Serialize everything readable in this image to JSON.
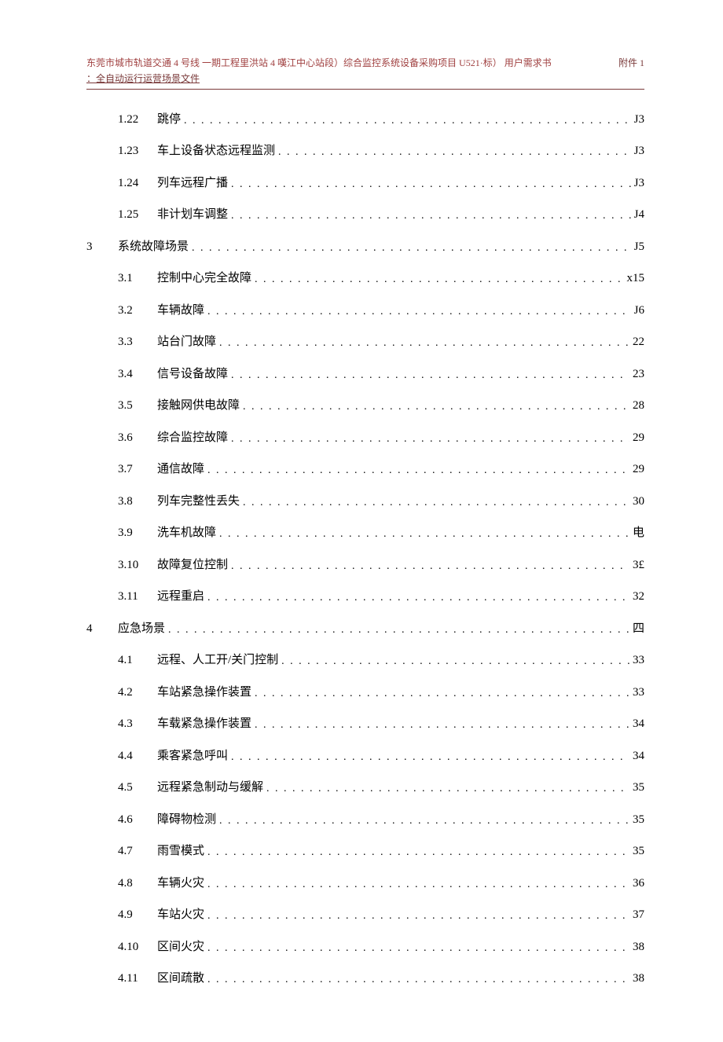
{
  "header": {
    "line1_a": "东莞市城市轨道交通 4",
    "line1_b": "号线",
    "line1_c": "一期工程里洪站 4 嘆江中心站段）综合监控系统设备采购项目 U521·标）",
    "line1_d": "用户需求书",
    "line1_right": "附件 1",
    "line2": "：全自动运行运营场景文件"
  },
  "toc": [
    {
      "lvl": 2,
      "num": "1.22",
      "title": "跳停",
      "page": "J3"
    },
    {
      "lvl": 2,
      "num": "1.23",
      "title": "车上设备状态远程监测",
      "page": "J3"
    },
    {
      "lvl": 2,
      "num": "1.24",
      "title": "列车远程广播",
      "page": "J3"
    },
    {
      "lvl": 2,
      "num": "1.25",
      "title": "非计划车调整",
      "page": "J4"
    },
    {
      "lvl": 1,
      "num": "3",
      "title": "系统故障场景",
      "page": "J5"
    },
    {
      "lvl": 2,
      "num": "3.1",
      "title": "控制中心完全故障",
      "page": "x15"
    },
    {
      "lvl": 2,
      "num": "3.2",
      "title": "车辆故障",
      "page": "J6"
    },
    {
      "lvl": 2,
      "num": "3.3",
      "title": "站台门故障",
      "page": "22"
    },
    {
      "lvl": 2,
      "num": "3.4",
      "title": "信号设备故障",
      "page": "23"
    },
    {
      "lvl": 2,
      "num": "3.5",
      "title": "接触网供电故障",
      "page": "28"
    },
    {
      "lvl": 2,
      "num": "3.6",
      "title": "综合监控故障",
      "page": "29"
    },
    {
      "lvl": 2,
      "num": "3.7",
      "title": "通信故障",
      "page": "29"
    },
    {
      "lvl": 2,
      "num": "3.8",
      "title": "列车完整性丢失",
      "page": "30"
    },
    {
      "lvl": 2,
      "num": "3.9",
      "title": "洗车机故障",
      "page": "电"
    },
    {
      "lvl": 2,
      "num": "3.10",
      "title": "故障复位控制",
      "page": "3£"
    },
    {
      "lvl": 2,
      "num": "3.11",
      "title": "远程重启",
      "page": "32"
    },
    {
      "lvl": 1,
      "num": "4",
      "title": "应急场景",
      "page": "四"
    },
    {
      "lvl": 2,
      "num": "4.1",
      "title": "远程、人工开/关门控制",
      "page": "33"
    },
    {
      "lvl": 2,
      "num": "4.2",
      "title": "车站紧急操作装置",
      "page": "33"
    },
    {
      "lvl": 2,
      "num": "4.3",
      "title": "车载紧急操作装置",
      "page": "34"
    },
    {
      "lvl": 2,
      "num": "4.4",
      "title": "乘客紧急呼叫",
      "page": "34"
    },
    {
      "lvl": 2,
      "num": "4.5",
      "title": "远程紧急制动与缓解",
      "page": "35"
    },
    {
      "lvl": 2,
      "num": "4.6",
      "title": "障碍物检测",
      "page": "35"
    },
    {
      "lvl": 2,
      "num": "4.7",
      "title": "雨雪模式",
      "page": "35"
    },
    {
      "lvl": 2,
      "num": "4.8",
      "title": "车辆火灾",
      "page": "36"
    },
    {
      "lvl": 2,
      "num": "4.9",
      "title": "车站火灾",
      "page": "37"
    },
    {
      "lvl": 2,
      "num": "4.10",
      "title": "区间火灾",
      "page": "38"
    },
    {
      "lvl": 2,
      "num": "4.11",
      "title": "区间疏散",
      "page": "38"
    }
  ]
}
